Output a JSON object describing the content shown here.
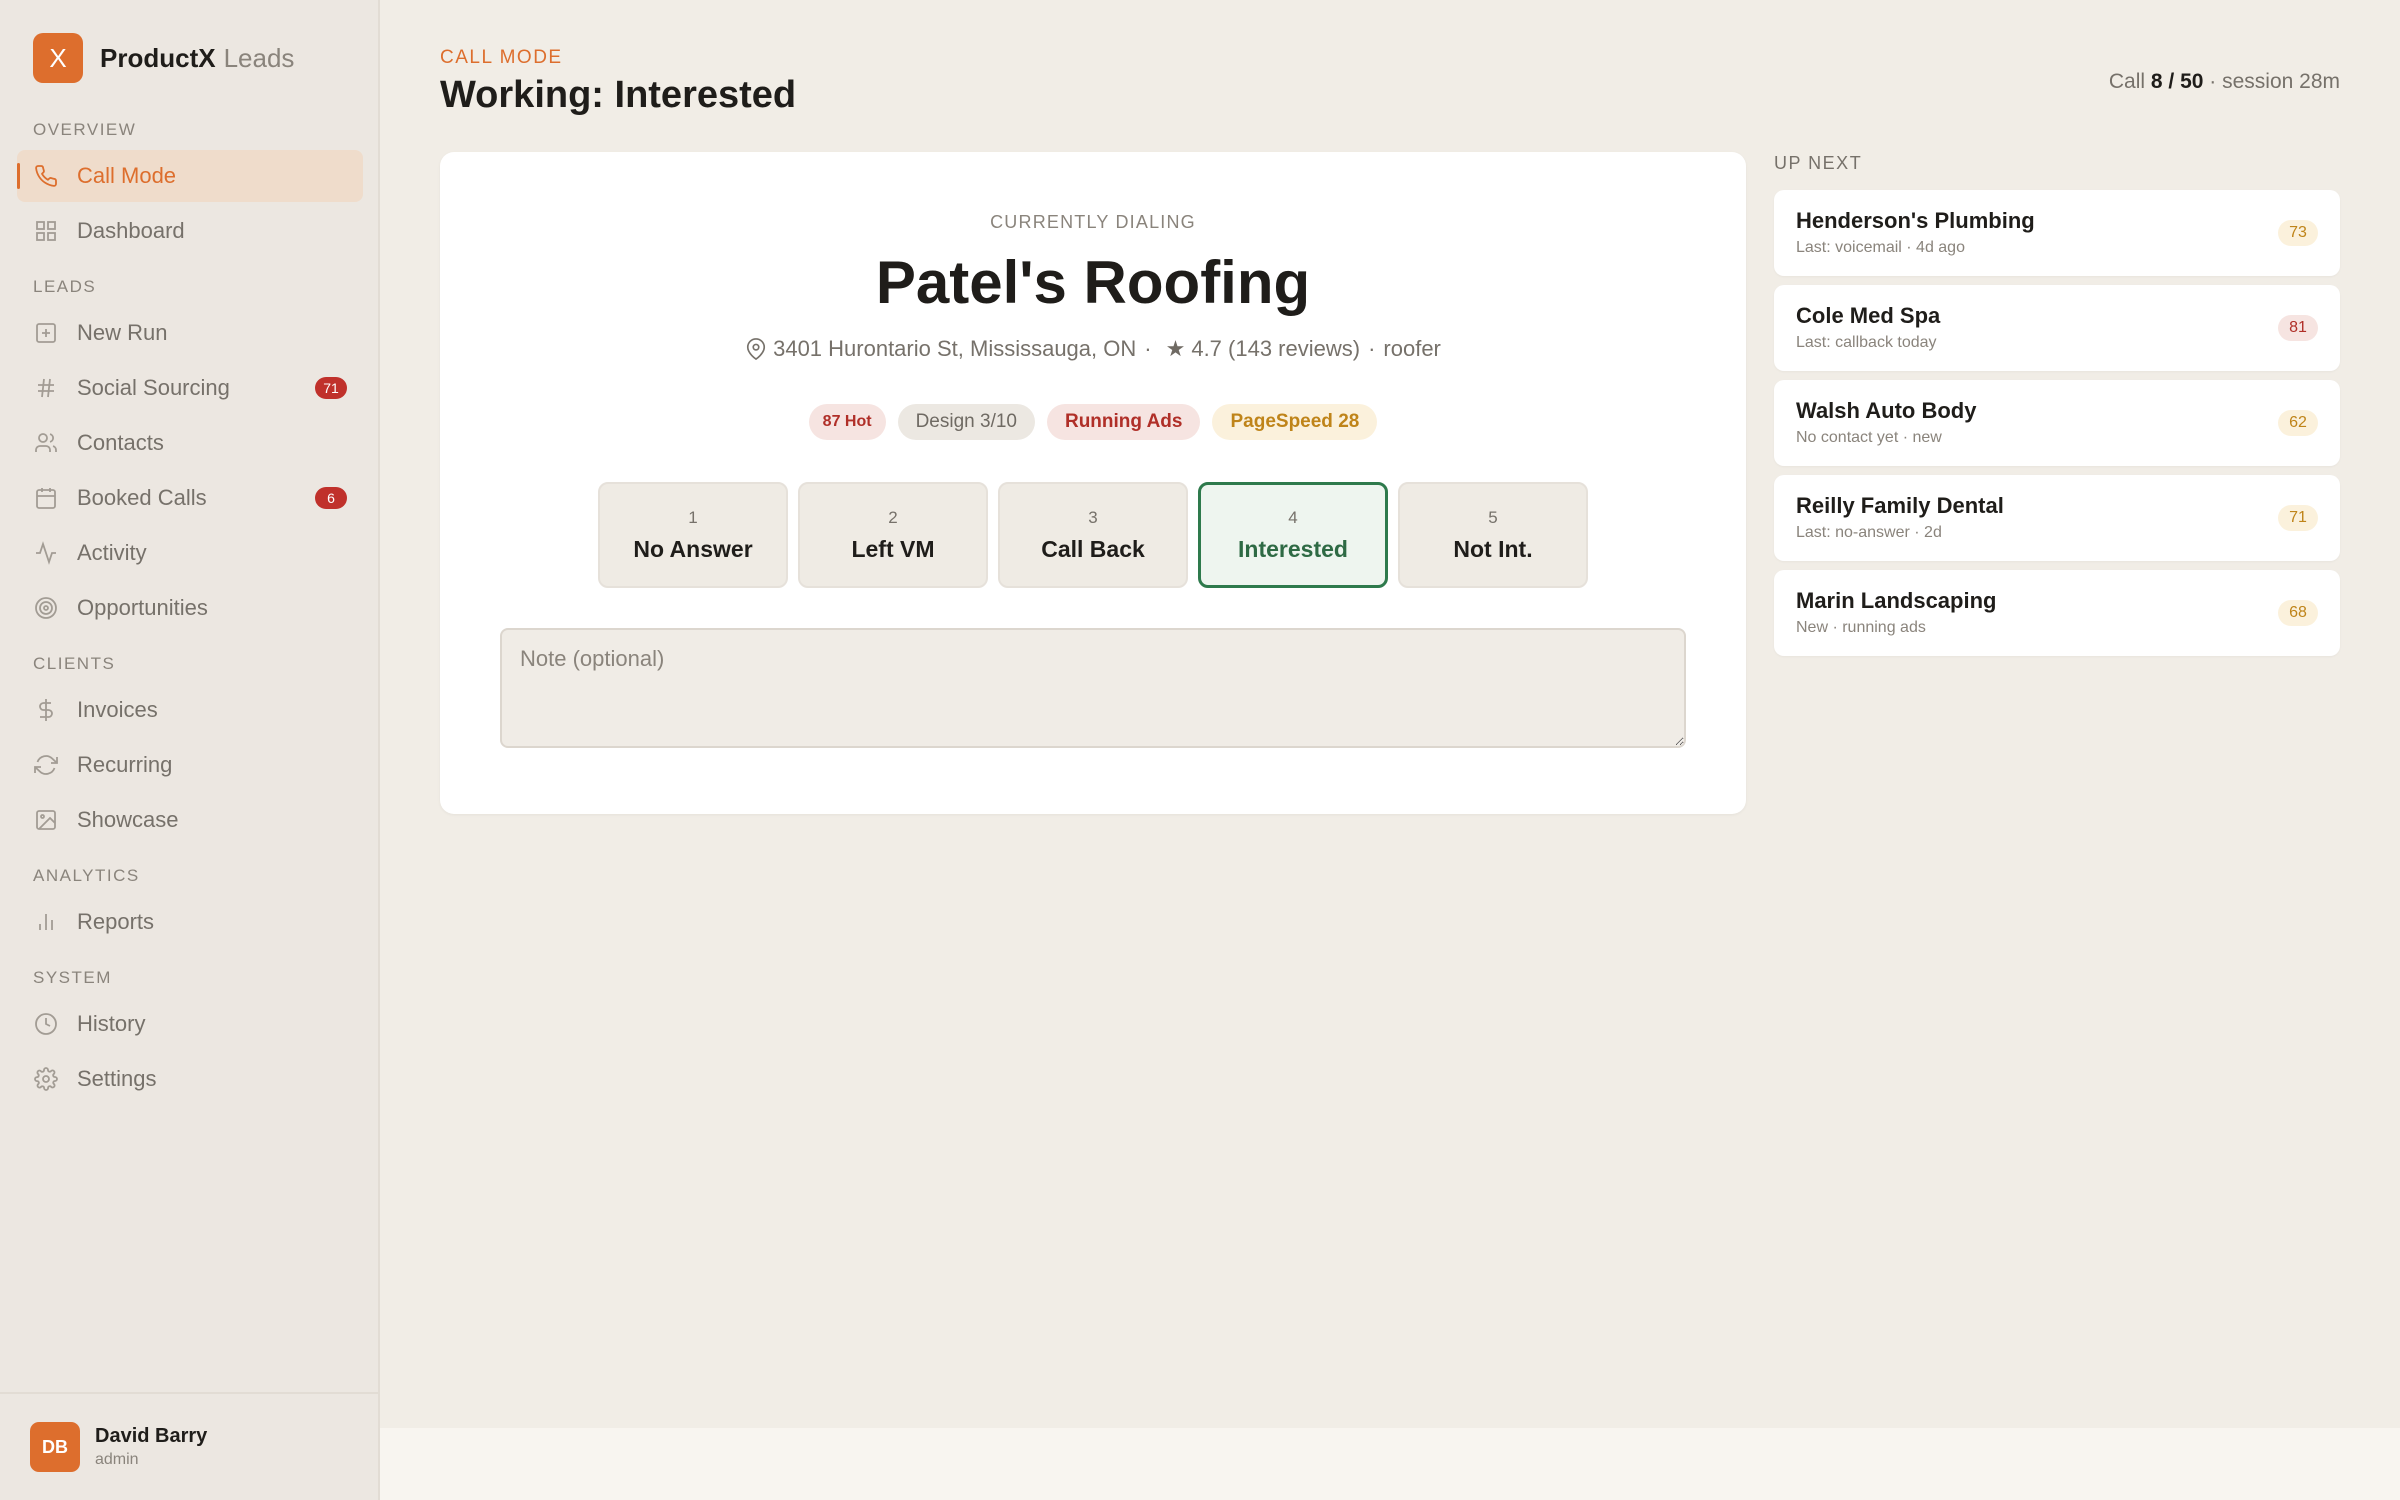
{
  "brand": {
    "logo": "X",
    "name": "ProductX",
    "sub": "Leads"
  },
  "sidebar": {
    "sections": [
      {
        "title": "OVERVIEW",
        "items": [
          {
            "label": "Call Mode",
            "icon": "phone-icon",
            "active": true
          },
          {
            "label": "Dashboard",
            "icon": "grid-icon"
          }
        ]
      },
      {
        "title": "LEADS",
        "items": [
          {
            "label": "New Run",
            "icon": "plus-square-icon"
          },
          {
            "label": "Social Sourcing",
            "icon": "hash-icon",
            "badge": "71"
          },
          {
            "label": "Contacts",
            "icon": "users-icon"
          },
          {
            "label": "Booked Calls",
            "icon": "calendar-icon",
            "badge": "6"
          },
          {
            "label": "Activity",
            "icon": "activity-icon"
          },
          {
            "label": "Opportunities",
            "icon": "target-icon"
          }
        ]
      },
      {
        "title": "CLIENTS",
        "items": [
          {
            "label": "Invoices",
            "icon": "dollar-icon"
          },
          {
            "label": "Recurring",
            "icon": "refresh-icon"
          },
          {
            "label": "Showcase",
            "icon": "image-icon"
          }
        ]
      },
      {
        "title": "ANALYTICS",
        "items": [
          {
            "label": "Reports",
            "icon": "bar-chart-icon"
          }
        ]
      },
      {
        "title": "SYSTEM",
        "items": [
          {
            "label": "History",
            "icon": "clock-icon"
          },
          {
            "label": "Settings",
            "icon": "gear-icon"
          }
        ]
      }
    ]
  },
  "user": {
    "initials": "DB",
    "name": "David Barry",
    "role": "admin"
  },
  "header": {
    "eyebrow": "CALL MODE",
    "title": "Working: Interested",
    "session_prefix": "Call",
    "session_count": "8 / 50",
    "session_suffix": "· session 28m"
  },
  "dialer": {
    "label": "CURRENTLY DIALING",
    "lead_name": "Patel's Roofing",
    "address": "3401 Hurontario St, Mississauga, ON",
    "rating": "4.7 (143 reviews)",
    "category": "roofer",
    "tags": {
      "hot": "87 Hot",
      "design": "Design 3/10",
      "ads": "Running Ads",
      "speed": "PageSpeed 28"
    },
    "outcomes": [
      {
        "key": "1",
        "label": "No Answer"
      },
      {
        "key": "2",
        "label": "Left VM"
      },
      {
        "key": "3",
        "label": "Call Back"
      },
      {
        "key": "4",
        "label": "Interested",
        "selected": true
      },
      {
        "key": "5",
        "label": "Not Int."
      }
    ],
    "note_placeholder": "Note (optional)",
    "note_value": ""
  },
  "up_next": {
    "title": "UP NEXT",
    "items": [
      {
        "name": "Henderson's Plumbing",
        "sub": "Last: voicemail · 4d ago",
        "score": "73",
        "tone": "warm"
      },
      {
        "name": "Cole Med Spa",
        "sub": "Last: callback today",
        "score": "81",
        "tone": "hot"
      },
      {
        "name": "Walsh Auto Body",
        "sub": "No contact yet · new",
        "score": "62",
        "tone": "warm"
      },
      {
        "name": "Reilly Family Dental",
        "sub": "Last: no-answer · 2d",
        "score": "71",
        "tone": "warm"
      },
      {
        "name": "Marin Landscaping",
        "sub": "New · running ads",
        "score": "68",
        "tone": "warm"
      }
    ]
  },
  "colors": {
    "accent": "#dd6e2d",
    "success": "#2e7a4c",
    "danger": "#c0312b",
    "warning": "#bf8419"
  }
}
